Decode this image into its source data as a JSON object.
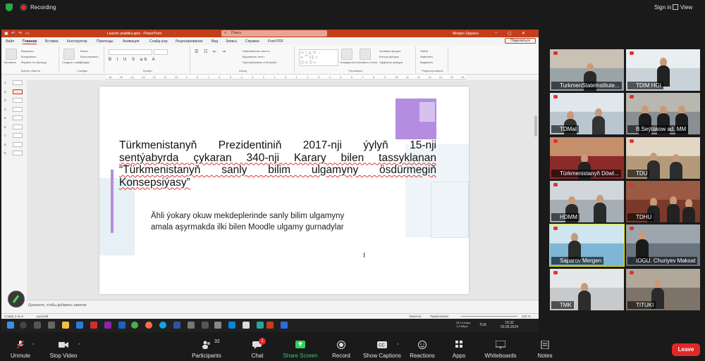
{
  "zoom": {
    "recording_label": "Recording",
    "sign_in_label": "Sign in",
    "view_label": "View",
    "controls": {
      "unmute": "Unmute",
      "stop_video": "Stop Video",
      "participants": "Participants",
      "participants_count": "32",
      "chat": "Chat",
      "chat_badge": "1",
      "share_screen": "Share Screen",
      "record": "Record",
      "show_captions": "Show Captions",
      "reactions": "Reactions",
      "apps": "Apps",
      "whiteboards": "Whiteboards",
      "notes": "Notes",
      "leave": "Leave"
    },
    "participants": [
      {
        "name": "TurkmenStateInstitute..."
      },
      {
        "name": "TDIM HGI"
      },
      {
        "name": "TDMaI"
      },
      {
        "name": "B.Seýtäkow ad. MM"
      },
      {
        "name": "Türkmenistanyň Döwl..."
      },
      {
        "name": "TDU"
      },
      {
        "name": "HDMM"
      },
      {
        "name": "TDHU"
      },
      {
        "name": "Saparov Mergen"
      },
      {
        "name": "IOGU. Churiyev Maksat"
      },
      {
        "name": "TMK"
      },
      {
        "name": "TITUKI"
      }
    ]
  },
  "powerpoint": {
    "doc_title": "Learnin analitiks.pptx  ·  PowerPoint",
    "search_placeholder": "Поиск",
    "user_name": "Mergen Saparov",
    "tabs": [
      "Файл",
      "Главная",
      "Вставка",
      "Конструктор",
      "Переходы",
      "Анимация",
      "Слайд-шоу",
      "Рецензирование",
      "Вид",
      "Запись",
      "Справка",
      "Foxit PDF"
    ],
    "active_tab": "Главная",
    "share_button": "Поделиться",
    "ribbon_groups": [
      "Буфер обмена",
      "Слайды",
      "Шрифт",
      "Абзац",
      "Рисование",
      "Редактирование"
    ],
    "ribbon_items": {
      "paste": "Вставить",
      "cut": "Вырезать",
      "copy": "Копировать",
      "format_painter": "Формат по образцу",
      "new_slide": "Создать слайд",
      "layout": "Макет",
      "reset": "Восстановить",
      "section": "Раздел",
      "text_direction": "Направление текста",
      "align_text": "Выровнять текст",
      "smartart": "Преобразовать в SmartArt",
      "arrange": "Упорядочить",
      "quick_styles": "Экспресс-стили",
      "shape_fill": "Заливка фигуры",
      "shape_outline": "Контур фигуры",
      "shape_effects": "Эффекты фигуры",
      "find": "Найти",
      "replace": "Заменить",
      "select": "Выделить"
    },
    "ruler_ticks": [
      "16",
      "15",
      "14",
      "13",
      "12",
      "11",
      "10",
      "9",
      "8",
      "7",
      "6",
      "5",
      "4",
      "3",
      "2",
      "1",
      "0",
      "1",
      "2",
      "3",
      "4",
      "5",
      "6",
      "7",
      "8",
      "9",
      "10",
      "11",
      "12",
      "13",
      "14",
      "15",
      "16"
    ],
    "thumbnails": [
      "1",
      "2",
      "3",
      "4",
      "5",
      "6",
      "7",
      "8",
      "9"
    ],
    "selected_thumbnail": "2",
    "slide": {
      "title_lines": [
        "Türkmenistanyň Prezidentiniň 2017-nji ýylyň 15-nji",
        "sentýabyrda çykaran 340-nji Karary bilen tassyklanan",
        "“Türkmenistanyň sanly bilim ulgamyny ösdürmegiň",
        "Konsepsiýasy”"
      ],
      "body_lines": [
        "Ähli ýokary okuw mekdeplerinde sanly bilim ulgamyny",
        "amala aşyrmakda ilki bilen Moodle ulgamy gurnadylar"
      ],
      "accent_color": "#b58de0"
    },
    "notes_placeholder": "Щелкните, чтобы добавить заметки",
    "status": {
      "slide_counter": "Слайд 2 из 9",
      "language": "русский",
      "notes_btn": "Заметки",
      "comments_btn": "Примечания",
      "zoom_level": "104 %"
    },
    "taskbar": {
      "network": "267,3 Kbps\n1,3 Mbps",
      "lang": "TUK",
      "time": "15:32",
      "date": "03.05.2024"
    }
  }
}
